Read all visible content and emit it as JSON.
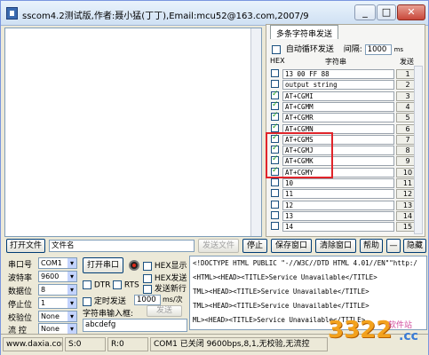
{
  "window": {
    "title": "sscom4.2测试版,作者:聂小猛(丁丁),Email:mcu52@163.com,2007/9",
    "min": "_",
    "max": "□",
    "close": "✕"
  },
  "multi": {
    "tab": "多条字符串发送",
    "auto_loop_label": "自动循环发送",
    "interval_label": "间隔:",
    "interval_value": "1000",
    "interval_unit": "ms",
    "col_hex": "HEX",
    "col_string": "字符串",
    "col_send": "发送",
    "rows": [
      {
        "checked": false,
        "cmd": "13 00 FF 88",
        "num": "1"
      },
      {
        "checked": false,
        "cmd": "output string",
        "num": "2"
      },
      {
        "checked": true,
        "cmd": "AT+CGMI",
        "num": "3"
      },
      {
        "checked": true,
        "cmd": "AT+CGMM",
        "num": "4"
      },
      {
        "checked": true,
        "cmd": "AT+CGMR",
        "num": "5"
      },
      {
        "checked": true,
        "cmd": "AT+CGMN",
        "num": "6"
      },
      {
        "checked": true,
        "cmd": "AT+CGMS",
        "num": "7"
      },
      {
        "checked": true,
        "cmd": "AT+CGMJ",
        "num": "8"
      },
      {
        "checked": true,
        "cmd": "AT+CGMK",
        "num": "9"
      },
      {
        "checked": true,
        "cmd": "AT+CGMY",
        "num": "10"
      },
      {
        "checked": false,
        "cmd": "10",
        "num": "11"
      },
      {
        "checked": false,
        "cmd": "11",
        "num": "12"
      },
      {
        "checked": false,
        "cmd": "12",
        "num": "13"
      },
      {
        "checked": false,
        "cmd": "13",
        "num": "14"
      },
      {
        "checked": false,
        "cmd": "14",
        "num": "15"
      }
    ]
  },
  "toolbar": {
    "open_file": "打开文件",
    "file_name": "文件名",
    "send_file": "发送文件",
    "stop": "停止",
    "save_window": "保存窗口",
    "clear_window": "清除窗口",
    "help": "帮助",
    "dash": "—",
    "hide": "隐藏"
  },
  "serial": {
    "port_label": "串口号",
    "port_value": "COM1",
    "baud_label": "波特率",
    "baud_value": "9600",
    "databits_label": "数据位",
    "databits_value": "8",
    "stopbits_label": "停止位",
    "stopbits_value": "1",
    "parity_label": "校验位",
    "parity_value": "None",
    "flow_label": "流 控",
    "flow_value": "None",
    "open_port": "打开串口",
    "hex_display": "HEX显示",
    "hex_send": "HEX发送",
    "send_newline": "发送新行",
    "dtr": "DTR",
    "rts": "RTS",
    "timed_send": "定时发送",
    "timed_value": "1000",
    "timed_unit": "ms/次",
    "string_input_label": "字符串输入框:",
    "send_button": "发送",
    "input_value": "abcdefg"
  },
  "output": {
    "lines": [
      "<!DOCTYPE HTML PUBLIC \"-//W3C//DTD HTML 4.01//EN\"\"http:/",
      "<HTML><HEAD><TITLE>Service Unavailable</TITLE>",
      "TML><HEAD><TITLE>Service Unavailable</TITLE>",
      "TML><HEAD><TITLE>Service Unavailable</TITLE>",
      "ML><HEAD><TITLE>Service Unavailable</TITLE>"
    ]
  },
  "status": {
    "site": "www.daxia.cor",
    "s": "S:0",
    "r": "R:0",
    "port_status": "COM1 已关闭  9600bps,8,1,无校验,无流控"
  },
  "logo": {
    "text": "3322",
    "sub": "软件站",
    "cc": ".cc"
  }
}
